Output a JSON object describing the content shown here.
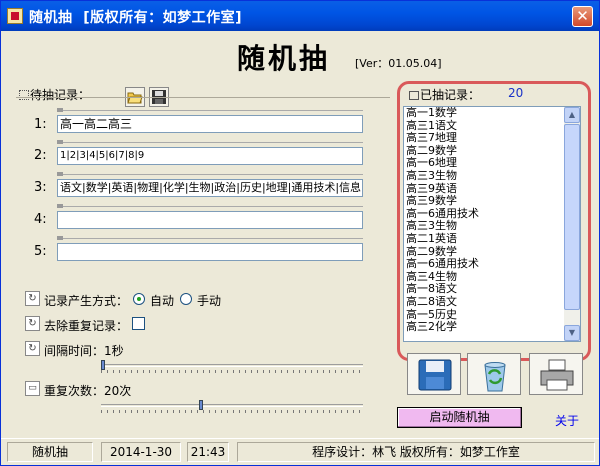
{
  "window": {
    "title": "随机抽  [版权所有：如梦工作室]",
    "close_label": "✕"
  },
  "app": {
    "title": "随机抽",
    "version": "[Ver：01.05.04]"
  },
  "pending": {
    "label": "待抽记录：",
    "rows": [
      {
        "num": "1:",
        "value": "高一高二高三"
      },
      {
        "num": "2:",
        "value": "1|2|3|4|5|6|7|8|9"
      },
      {
        "num": "3:",
        "value": "语文|数学|英语|物理|化学|生物|政治|历史|地理|通用技术|信息"
      },
      {
        "num": "4:",
        "value": ""
      },
      {
        "num": "5:",
        "value": ""
      }
    ]
  },
  "options": {
    "mode_label": "记录产生方式：",
    "mode_auto": "自动",
    "mode_manual": "手动",
    "dedupe_label": "去除重复记录：",
    "interval_label": "间隔时间：1秒",
    "repeat_label": "重复次数：20次",
    "interval_level": 0,
    "repeat_level": 0.38
  },
  "drawn": {
    "label": "已抽记录：",
    "count": "20",
    "items": [
      "高一1数学",
      "高三1语文",
      "高三7地理",
      "高二9数学",
      "高一6地理",
      "高三3生物",
      "高三9英语",
      "高三9数学",
      "高一6通用技术",
      "高三3生物",
      "高二1英语",
      "高二9数学",
      "高一6通用技术",
      "高三4生物",
      "高一8语文",
      "高二8语文",
      "高一5历史",
      "高三2化学"
    ]
  },
  "buttons": {
    "start": "启动随机抽",
    "about": "关于"
  },
  "status": {
    "app_name": "随机抽",
    "date": "2014-1-30",
    "time": "21:43",
    "credits": "程序设计：林飞  版权所有：如梦工作室"
  }
}
